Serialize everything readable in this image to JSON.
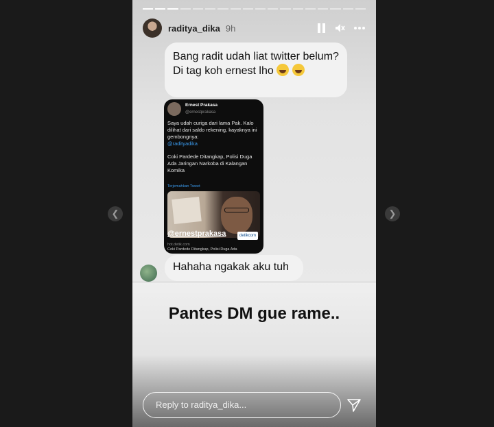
{
  "story": {
    "username": "raditya_dika",
    "time": "9h",
    "progress": {
      "total_segments": 18,
      "completed": 3
    }
  },
  "messages": {
    "first": "Bang radit udah liat twitter belum? Di tag koh ernest lho",
    "reply": "Hahaha ngakak aku tuh"
  },
  "tweet": {
    "name": "Ernest Prakasa",
    "handle": "@ernestprakasa",
    "line1": "Saya udah curiga dari lama Pak. Kalo dilihat dari saldo rekening, kayaknya ini gembongnya:",
    "mention": "@radityadika",
    "headline": "Coki Pardede Ditangkap, Polisi Duga Ada Jaringan Narkoba di Kalangan Komika",
    "translate": "Terjemahkan Tweet",
    "watermark": "@ernestprakasa",
    "detik": "detikcom",
    "source_domain": "hot.detik.com",
    "source_title": "Coki Pardede Ditangkap, Polisi Duga Ada"
  },
  "caption": "Pantes DM gue rame..",
  "reply_bar": {
    "placeholder": "Reply to raditya_dika..."
  },
  "icons": {
    "prev": "chevron-left-icon",
    "next": "chevron-right-icon",
    "pause": "pause-icon",
    "mute": "mute-icon",
    "more": "more-icon",
    "send": "send-icon"
  },
  "colors": {
    "page_bg": "#1a1a1a",
    "mention": "#3b9cf0",
    "bubble": "#f2f2f2"
  }
}
